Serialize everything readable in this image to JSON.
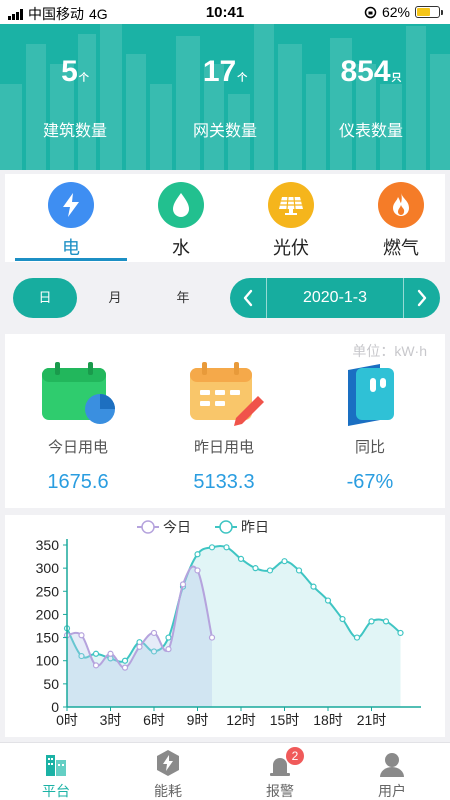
{
  "status_bar": {
    "carrier": "中国移动",
    "network": "4G",
    "time": "10:41",
    "battery": "62%",
    "battery_level": 0.62
  },
  "header": {
    "stats": [
      {
        "value": "5",
        "unit": "个",
        "label": "建筑数量"
      },
      {
        "value": "17",
        "unit": "个",
        "label": "网关数量"
      },
      {
        "value": "854",
        "unit": "只",
        "label": "仪表数量"
      }
    ]
  },
  "categories": [
    {
      "label": "电",
      "icon": "lightning-icon",
      "color": "#3e8ef2",
      "active": true
    },
    {
      "label": "水",
      "icon": "water-drop-icon",
      "color": "#22c08f",
      "active": false
    },
    {
      "label": "光伏",
      "icon": "solar-panel-icon",
      "color": "#f5b51c",
      "active": false
    },
    {
      "label": "燃气",
      "icon": "flame-icon",
      "color": "#f57c28",
      "active": false
    }
  ],
  "range_tabs": [
    {
      "label": "日",
      "active": true
    },
    {
      "label": "月"
    },
    {
      "label": "年"
    }
  ],
  "date": {
    "value": "2020-1-3"
  },
  "summary": {
    "unit_label": "单位：kW·h",
    "items": [
      {
        "label": "今日用电",
        "value": "1675.6",
        "icon": "calendar-icon"
      },
      {
        "label": "昨日用电",
        "value": "5133.3",
        "icon": "calendar-edit-icon"
      },
      {
        "label": "同比",
        "value": "-67%",
        "icon": "book-icon"
      }
    ]
  },
  "chart_data": {
    "type": "area",
    "legend": [
      "今日",
      "昨日"
    ],
    "x": [
      0,
      1,
      2,
      3,
      4,
      5,
      6,
      7,
      8,
      9,
      10,
      11,
      12,
      13,
      14,
      15,
      16,
      17,
      18,
      19,
      20,
      21,
      22,
      23
    ],
    "xtick_labels": [
      "0时",
      "3时",
      "6时",
      "9时",
      "12时",
      "15时",
      "18时",
      "21时"
    ],
    "ylim": [
      0,
      350
    ],
    "yticks": [
      0,
      50,
      100,
      150,
      200,
      250,
      300,
      350
    ],
    "series": [
      {
        "name": "今日",
        "color": "#b5a3dd",
        "values": [
          155,
          155,
          90,
          115,
          85,
          130,
          160,
          125,
          265,
          295,
          150
        ]
      },
      {
        "name": "昨日",
        "color": "#3fc5c3",
        "values": [
          170,
          110,
          115,
          105,
          100,
          140,
          120,
          150,
          260,
          330,
          345,
          345,
          320,
          300,
          295,
          315,
          295,
          260,
          230,
          190,
          150,
          185,
          185,
          160
        ]
      }
    ]
  },
  "bottom_nav": [
    {
      "label": "平台",
      "icon": "building-icon",
      "active": true
    },
    {
      "label": "能耗",
      "icon": "energy-icon"
    },
    {
      "label": "报警",
      "icon": "alarm-icon",
      "badge": "2"
    },
    {
      "label": "用户",
      "icon": "user-icon"
    }
  ]
}
